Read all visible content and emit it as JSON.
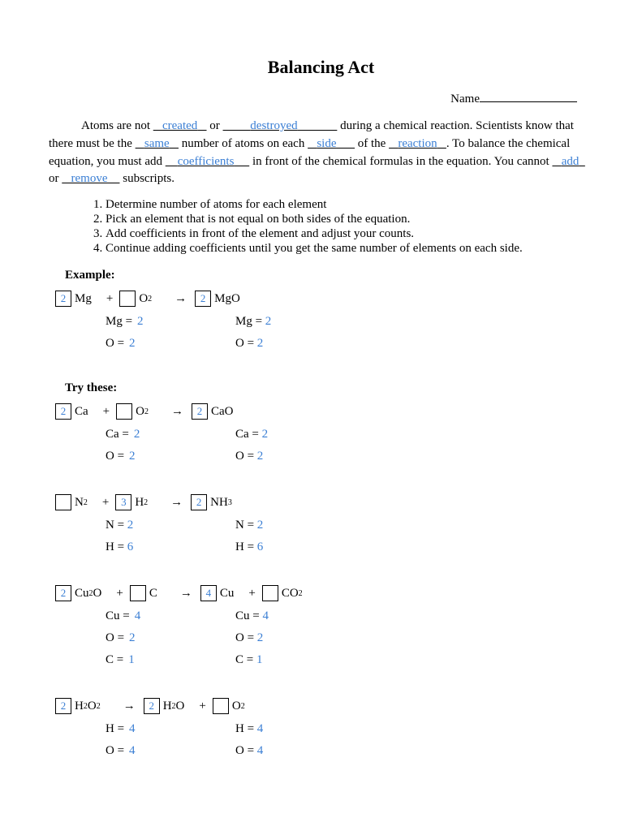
{
  "title": "Balancing Act",
  "name_label": "Name",
  "para": {
    "t1": "Atoms are not ",
    "f1": "created",
    "t2": " or ",
    "f2": "destroyed",
    "t3": " during a chemical reaction. Scientists know that there must be the ",
    "f3": "same",
    "t4": " number of atoms on each ",
    "f4": "side",
    "t5": " of the ",
    "f5": "reaction",
    "t6": ". To balance the chemical equation, you must add ",
    "f6": "coefficients",
    "t7": " in front of the chemical formulas in the equation. You cannot ",
    "f7": "add",
    "t8": " or ",
    "f8": "remove",
    "t9": " subscripts."
  },
  "steps": [
    "Determine number of atoms for each element",
    "Pick an element that is not equal on both sides of the equation.",
    "Add coefficients in front of the element and adjust your counts.",
    "Continue adding coefficients until you get the same number of elements on each side."
  ],
  "example_label": "Example:",
  "try_label": "Try these:",
  "plus": "+",
  "arrow": "→",
  "eq1": {
    "c1": "2",
    "s1": "Mg",
    "c2": "",
    "s2a": "O",
    "s2b": "2",
    "c3": "2",
    "s3": "MgO",
    "left": [
      {
        "el": "Mg =",
        "v": "2"
      },
      {
        "el": "O =",
        "v": "2"
      }
    ],
    "right": [
      {
        "el": "Mg =",
        "v": "2"
      },
      {
        "el": "O =",
        "v": "2"
      }
    ]
  },
  "eq2": {
    "c1": "2",
    "s1": "Ca",
    "c2": "",
    "s2a": "O",
    "s2b": "2",
    "c3": "2",
    "s3": "CaO",
    "left": [
      {
        "el": "Ca =",
        "v": "2"
      },
      {
        "el": "O =",
        "v": "2"
      }
    ],
    "right": [
      {
        "el": "Ca =",
        "v": "2"
      },
      {
        "el": "O =",
        "v": "2"
      }
    ]
  },
  "eq3": {
    "c1": "",
    "s1a": "N",
    "s1b": "2",
    "c2": "3",
    "s2a": "H",
    "s2b": "2",
    "c3": "2",
    "s3a": "NH",
    "s3b": "3",
    "left": [
      {
        "el": "N =",
        "v": "2"
      },
      {
        "el": "H =",
        "v": "6"
      }
    ],
    "right": [
      {
        "el": "N =",
        "v": "2"
      },
      {
        "el": "H =",
        "v": "6"
      }
    ]
  },
  "eq4": {
    "c1": "2",
    "s1a": "Cu",
    "s1b": "2",
    "s1c": "O",
    "c2": "",
    "s2": "C",
    "c3": "4",
    "s3": "Cu",
    "c4": "",
    "s4a": "CO",
    "s4b": "2",
    "left": [
      {
        "el": "Cu =",
        "v": "4"
      },
      {
        "el": "O =",
        "v": "2"
      },
      {
        "el": "C =",
        "v": "1"
      }
    ],
    "right": [
      {
        "el": "Cu =",
        "v": "4"
      },
      {
        "el": "O =",
        "v": "2"
      },
      {
        "el": "C =",
        "v": "1"
      }
    ]
  },
  "eq5": {
    "c1": "2",
    "s1a": "H",
    "s1b": "2",
    "s1c": "O",
    "s1d": "2",
    "c2": "2",
    "s2a": "H",
    "s2b": "2",
    "s2c": "O",
    "c3": "",
    "s3a": "O",
    "s3b": "2",
    "left": [
      {
        "el": "H =",
        "v": "4"
      },
      {
        "el": "O =",
        "v": "4"
      }
    ],
    "right": [
      {
        "el": "H =",
        "v": "4"
      },
      {
        "el": "O =",
        "v": "4"
      }
    ]
  }
}
